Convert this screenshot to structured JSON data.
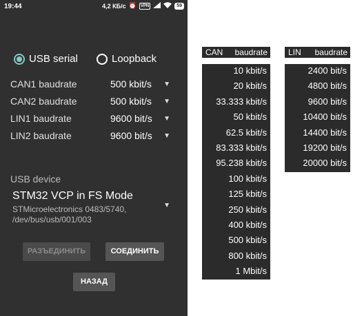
{
  "status_bar": {
    "time": "19:44",
    "net_speed": "4,2 КБ/с",
    "vpn": "VPN",
    "battery": "59"
  },
  "mode": {
    "usb_serial_label": "USB serial",
    "loopback_label": "Loopback",
    "selected": "USB serial"
  },
  "settings": [
    {
      "label": "CAN1 baudrate",
      "value": "500 kbit/s"
    },
    {
      "label": "CAN2 baudrate",
      "value": "500 kbit/s"
    },
    {
      "label": "LIN1 baudrate",
      "value": "9600 bit/s"
    },
    {
      "label": "LIN2 baudrate",
      "value": "9600 bit/s"
    }
  ],
  "usb_device": {
    "section_label": "USB device",
    "name": "STM32 VCP in FS Mode",
    "description": "STMicroelectronics 0483/5740, /dev/bus/usb/001/003"
  },
  "buttons": {
    "disconnect": "РАЗЪЕДИНИТЬ",
    "connect": "СОЕДИНИТЬ",
    "back": "НАЗАД"
  },
  "can_table": {
    "header_left": "CAN",
    "header_right": "baudrate",
    "values": [
      "10 kbit/s",
      "20 kbit/s",
      "33.333 kbit/s",
      "50 kbit/s",
      "62.5 kbit/s",
      "83.333 kbit/s",
      "95.238 kbit/s",
      "100 kbit/s",
      "125 kbit/s",
      "250 kbit/s",
      "400 kbit/s",
      "500 kbit/s",
      "800 kbit/s",
      "1 Mbit/s"
    ]
  },
  "lin_table": {
    "header_left": "LIN",
    "header_right": "baudrate",
    "values": [
      "2400 bit/s",
      "4800 bit/s",
      "9600 bit/s",
      "10400 bit/s",
      "14400 bit/s",
      "19200 bit/s",
      "20000 bit/s"
    ]
  },
  "colors": {
    "phone_bg": "#303030",
    "table_bg": "#2b2b2b",
    "radio_accent": "#80cbc4"
  }
}
